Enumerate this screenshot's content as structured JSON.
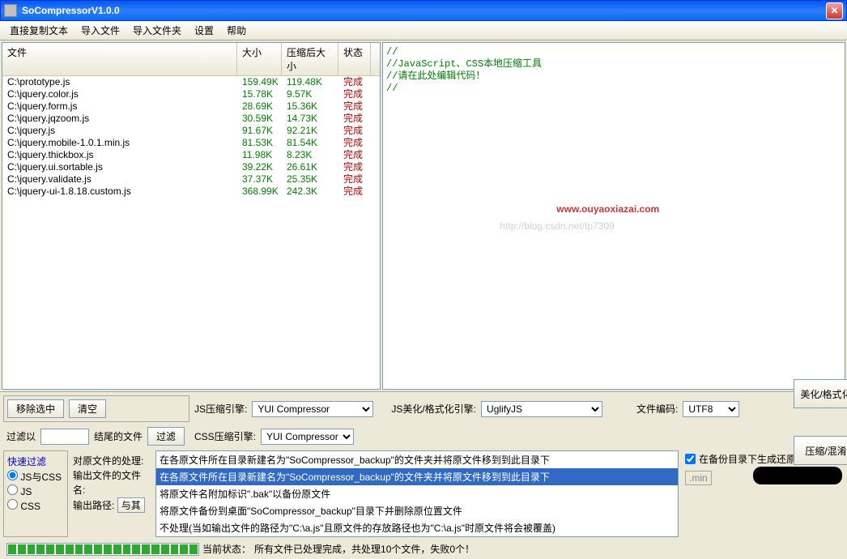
{
  "window": {
    "title": "SoCompressorV1.0.0"
  },
  "menu": [
    "直接复制文本",
    "导入文件",
    "导入文件夹",
    "设置",
    "帮助"
  ],
  "columns": {
    "file": "文件",
    "size": "大小",
    "csize": "压缩后大小",
    "status": "状态"
  },
  "files": [
    {
      "path": "C:\\prototype.js",
      "size": "159.49K",
      "csize": "119.48K",
      "status": "完成"
    },
    {
      "path": "C:\\jquery.color.js",
      "size": "15.78K",
      "csize": "9.57K",
      "status": "完成"
    },
    {
      "path": "C:\\jquery.form.js",
      "size": "28.69K",
      "csize": "15.36K",
      "status": "完成"
    },
    {
      "path": "C:\\jquery.jqzoom.js",
      "size": "30.59K",
      "csize": "14.73K",
      "status": "完成"
    },
    {
      "path": "C:\\jquery.js",
      "size": "91.67K",
      "csize": "92.21K",
      "status": "完成"
    },
    {
      "path": "C:\\jquery.mobile-1.0.1.min.js",
      "size": "81.53K",
      "csize": "81.54K",
      "status": "完成"
    },
    {
      "path": "C:\\jquery.thickbox.js",
      "size": "11.98K",
      "csize": "8.23K",
      "status": "完成"
    },
    {
      "path": "C:\\jquery.ui.sortable.js",
      "size": "39.22K",
      "csize": "26.61K",
      "status": "完成"
    },
    {
      "path": "C:\\jquery.validate.js",
      "size": "37.37K",
      "csize": "25.35K",
      "status": "完成"
    },
    {
      "path": "C:\\jquery-ui-1.8.18.custom.js",
      "size": "368.99K",
      "csize": "242.3K",
      "status": "完成"
    }
  ],
  "editor": {
    "text": "//\n//JavaScript、CSS本地压缩工具\n//请在此处编辑代码！\n//",
    "watermark_gray": "http://blog.csdn.net/tp7309",
    "watermark_red": "www.ouyaoxiazai.com"
  },
  "controls": {
    "remove_sel": "移除选中",
    "clear": "清空",
    "js_engine_label": "JS压缩引擎:",
    "js_engine_value": "YUI Compressor",
    "css_engine_label": "CSS压缩引擎:",
    "css_engine_value": "YUI Compressor",
    "beautify_engine_label": "JS美化/格式化引擎:",
    "beautify_engine_value": "UglifyJS",
    "encoding_label": "文件编码:",
    "encoding_value": "UTF8",
    "filter_by": "过滤以",
    "end_files": "结尾的文件",
    "filter_btn": "过滤",
    "quick_filter": "快速过滤",
    "radio_jscss": "JS与CSS",
    "radio_js": "JS",
    "radio_css": "CSS",
    "opt_handle": "对原文件的处理:",
    "opt_outname": "输出文件的文件名:",
    "opt_outpath": "输出路径:",
    "outpath_prefix": "与其",
    "backup_checkbox": "在备份目录下生成还原脚本",
    "min_suffix": ".min",
    "beautify_btn": "美化/格式化",
    "compress_btn": "压缩/混淆"
  },
  "dropdown_options": [
    "在各原文件所在目录新建名为\"SoCompressor_backup\"的文件夹并将原文件移到到此目录下",
    "在各原文件所在目录新建名为\"SoCompressor_backup\"的文件夹并将原文件移到到此目录下",
    "将原文件名附加标识\".bak\"以备份原文件",
    "将原文件备份到桌面\"SoCompressor_backup\"目录下并删除原位置文件",
    "不处理(当如输出文件的路径为\"C:\\a.js\"且原文件的存放路径也为\"C:\\a.js\"时原文件将会被覆盖)"
  ],
  "status": {
    "label": "当前状态：",
    "text": "所有文件已处理完成，共处理10个文件，失败0个！"
  }
}
